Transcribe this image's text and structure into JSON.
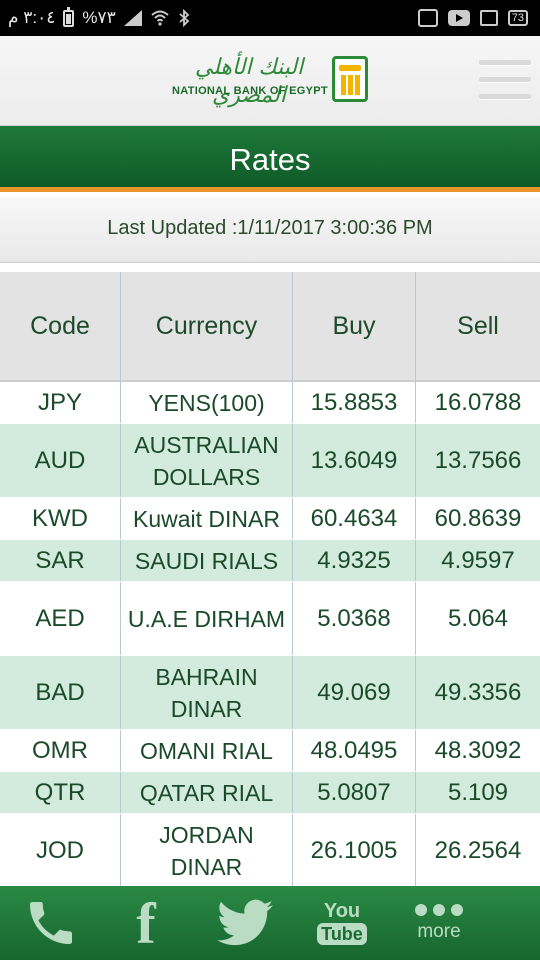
{
  "status_bar": {
    "time": "٣:٠٤ م",
    "battery_percent": "%٧٣",
    "battery_right": "73"
  },
  "header": {
    "logo_arabic": "البنك الأهلي المصري",
    "logo_english": "NATIONAL BANK OF EGYPT"
  },
  "title": "Rates",
  "last_updated": "Last Updated :1/11/2017 3:00:36 PM",
  "table": {
    "headers": [
      "Code",
      "Currency",
      "Buy",
      "Sell"
    ],
    "rows": [
      {
        "code": "JPY",
        "currency": "YENS(100)",
        "buy": "15.8853",
        "sell": "16.0788"
      },
      {
        "code": "AUD",
        "currency": "AUSTRALIAN DOLLARS",
        "buy": "13.6049",
        "sell": "13.7566"
      },
      {
        "code": "KWD",
        "currency": "Kuwait DINAR",
        "buy": "60.4634",
        "sell": "60.8639"
      },
      {
        "code": "SAR",
        "currency": "SAUDI RIALS",
        "buy": "4.9325",
        "sell": "4.9597"
      },
      {
        "code": "AED",
        "currency": "U.A.E DIRHAM",
        "buy": "5.0368",
        "sell": "5.064"
      },
      {
        "code": "BAD",
        "currency": "BAHRAIN DINAR",
        "buy": "49.069",
        "sell": "49.3356"
      },
      {
        "code": "OMR",
        "currency": "OMANI RIAL",
        "buy": "48.0495",
        "sell": "48.3092"
      },
      {
        "code": "QTR",
        "currency": "QATAR RIAL",
        "buy": "5.0807",
        "sell": "5.109"
      },
      {
        "code": "JOD",
        "currency": "JORDAN DINAR",
        "buy": "26.1005",
        "sell": "26.2564"
      }
    ]
  },
  "bottom_nav": {
    "facebook_glyph": "f",
    "youtube_you": "You",
    "youtube_tube": "Tube",
    "more_label": "more"
  },
  "icons": [
    "phone-icon",
    "facebook-icon",
    "twitter-icon",
    "youtube-icon",
    "more-icon",
    "menu-icon",
    "wifi-icon",
    "bluetooth-icon",
    "signal-icon",
    "battery-icon"
  ],
  "colors": {
    "primary_green": "#1f7a3a",
    "accent_orange": "#e8952a",
    "row_alt": "#d3ebdc"
  }
}
